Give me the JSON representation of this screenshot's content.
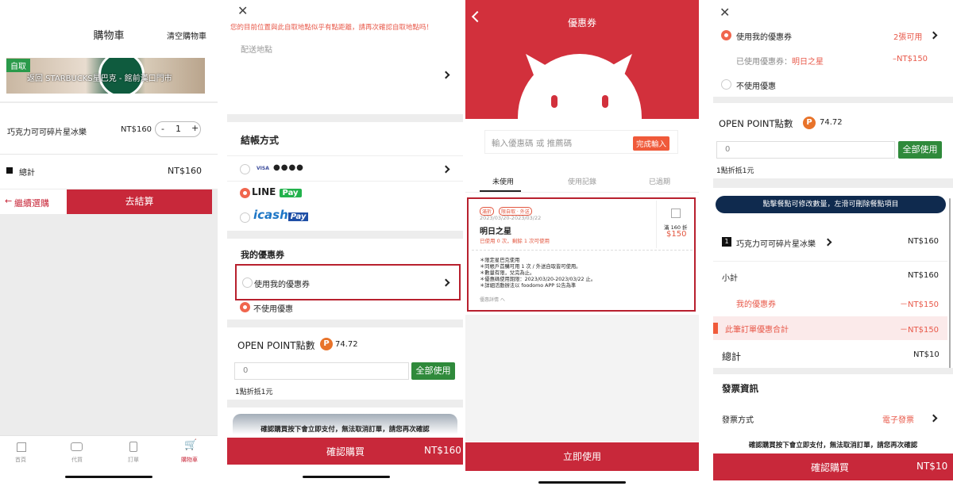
{
  "p1": {
    "title": "購物車",
    "clear_cart": "清空購物車",
    "store_tag": "自取",
    "store_name": "返回 STARBUCKS星巴克 - 館前漢口門市",
    "item_name": "巧克力可可碎片星冰樂",
    "item_price": "NT$160",
    "qty": "1",
    "minus": "-",
    "plus": "+",
    "total_label": "總計",
    "total_value": "NT$160",
    "continue": "繼續選購",
    "checkout": "去結算",
    "nav": [
      "首頁",
      "代買",
      "訂單",
      "購物車"
    ]
  },
  "p2": {
    "warning": "您的目前位置與此自取地點似乎有點距離，請再次確認自取地點吗！",
    "delivery_label": "配送地點",
    "payment_title": "結帳方式",
    "visa": "VISA",
    "card_dots": "●●●●",
    "line_pay_a": "LINE",
    "line_pay_b": "Pay",
    "icash": "icash",
    "icash_pay": "Pay",
    "coupon_title": "我的優惠券",
    "use_coupon": "使用我的優惠券",
    "no_coupon": "不使用優惠",
    "op_title": "OPEN POINT點數",
    "op_icon": "P",
    "op_value": "74.72",
    "op_input": "0",
    "use_all": "全部使用",
    "op_note": "1點折抵1元",
    "confirm_note": "確認購買按下會立即支付，無法取消訂單，請您再次確認",
    "buy": "確認購買",
    "buy_price": "NT$160"
  },
  "p3": {
    "title": "優惠券",
    "coupon_placeholder": "輸入優惠碼 或 推薦碼",
    "apply": "完成輸入",
    "tabs": [
      "未使用",
      "使用記錄",
      "已過期"
    ],
    "tag1": "滿折",
    "tag2": "限自取 · 外送",
    "date": "2023/03/20-2023/03/22",
    "coupon_name": "明日之星",
    "usage": "已使用 0 次，剩餘 1 次可使用",
    "min_spend": "滿 160 折",
    "discount": "$150",
    "rules": [
      "＊限定星巴克使用",
      "＊同帳戶首購可用 1 次 / 外送自取皆可使用。",
      "＊數量有限，兌完為止。",
      "＊優惠碼使用期限：2023/03/20-2023/03/22 止。",
      "＊詳細活動辦法以 foodomo APP 公告為準"
    ],
    "rules_toggle": "優惠詳情 へ",
    "use_now": "立即使用"
  },
  "p4": {
    "use_coupon": "使用我的優惠券",
    "available": "2張可用",
    "used_label": "已使用優惠券：",
    "used_name": "明日之星",
    "used_amount": "–NT$150",
    "no_coupon": "不使用優惠",
    "op_title": "OPEN POINT點數",
    "op_icon": "P",
    "op_value": "74.72",
    "op_input": "0",
    "use_all": "全部使用",
    "op_note": "1點折抵1元",
    "banner": "點擊餐點可修改數量，左滑可刪除餐點項目",
    "item_qty": "1",
    "item_name": "巧克力可可碎片星冰樂",
    "item_price": "NT$160",
    "subtotal_label": "小計",
    "subtotal_value": "NT$160",
    "coupon_label": "我的優惠券",
    "coupon_value": "－NT$150",
    "order_discount_label": "此筆訂單優惠合計",
    "order_discount_value": "－NT$150",
    "total_label": "總計",
    "total_value": "NT$10",
    "invoice_title": "發票資訊",
    "invoice_method_label": "發票方式",
    "invoice_method_value": "電子發票",
    "confirm_note": "確認購買按下會立即支付，無法取消訂單，請您再次確認",
    "buy": "確認購買",
    "buy_price": "NT$10"
  }
}
